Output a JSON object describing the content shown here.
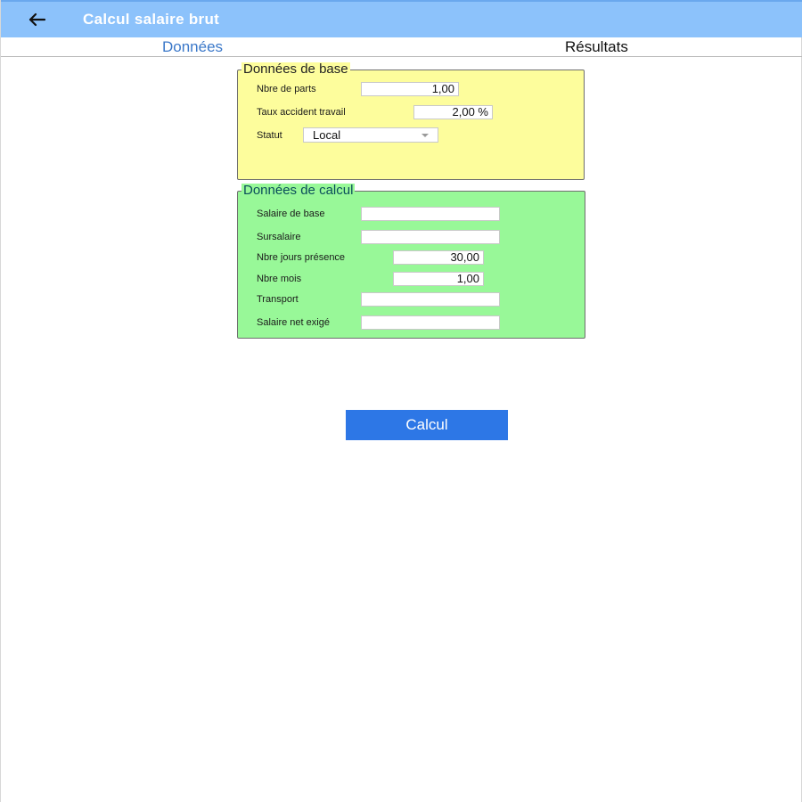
{
  "appbar": {
    "title": "Calcul salaire brut",
    "back_icon": "arrow-left-icon"
  },
  "tabs": [
    {
      "label": "Données",
      "active": true
    },
    {
      "label": "Résultats",
      "active": false
    }
  ],
  "base_group": {
    "title": "Données de base",
    "background_color": "#fdfd9c",
    "fields": {
      "parts": {
        "label": "Nbre de parts",
        "value": "1,00"
      },
      "accident": {
        "label": "Taux accident travail",
        "value": "2,00 %"
      },
      "statut": {
        "label": "Statut",
        "value": "Local"
      }
    }
  },
  "calc_group": {
    "title": "Données de calcul",
    "background_color": "#98f898",
    "fields": {
      "salaire_base": {
        "label": "Salaire de base",
        "value": ""
      },
      "sursalaire": {
        "label": "Sursalaire",
        "value": ""
      },
      "jours": {
        "label": "Nbre jours présence",
        "value": "30,00"
      },
      "mois": {
        "label": "Nbre mois",
        "value": "1,00"
      },
      "transport": {
        "label": "Transport",
        "value": ""
      },
      "salaire_net": {
        "label": "Salaire net exigé",
        "value": ""
      }
    }
  },
  "actions": {
    "calcul_label": "Calcul",
    "button_color": "#2d77e6"
  },
  "colors": {
    "appbar": "#8cc2fb",
    "tab_active": "#3b78c9"
  }
}
